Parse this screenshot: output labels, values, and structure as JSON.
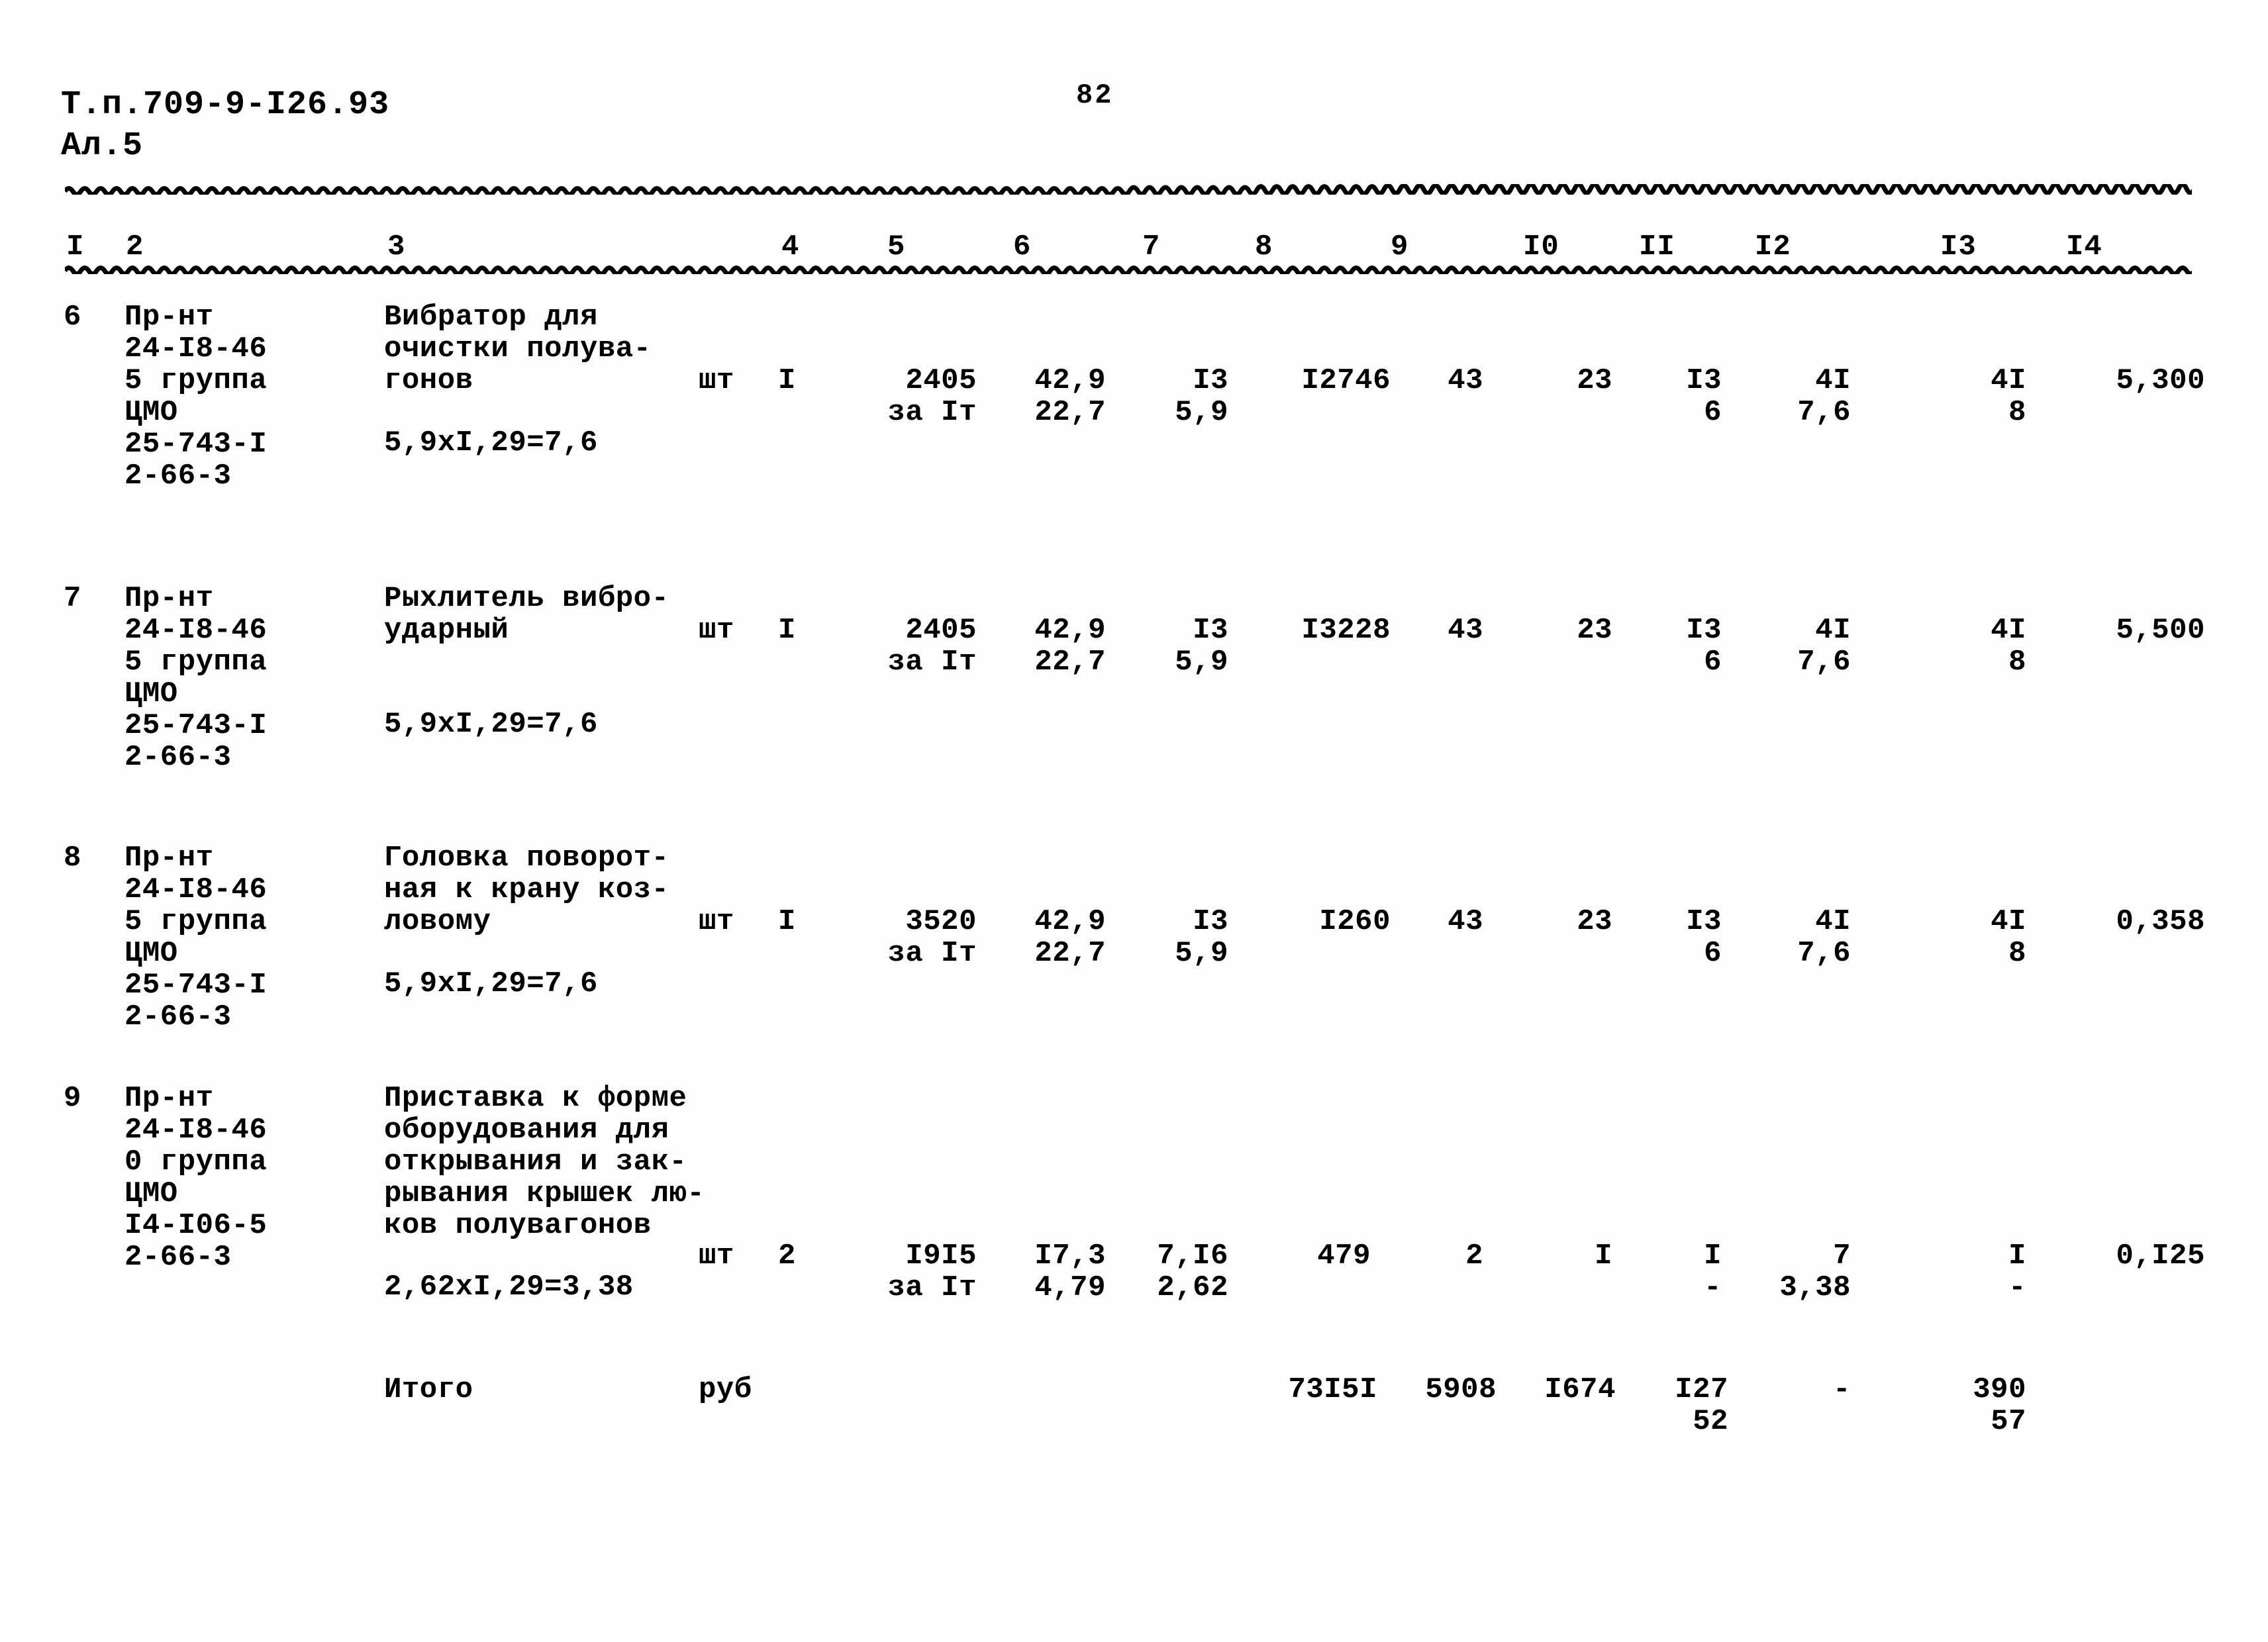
{
  "header": {
    "doc_code_line1": "Т.п.709-9-I26.93",
    "doc_code_line2": "Ал.5",
    "page_number": "82"
  },
  "table": {
    "column_headers": [
      "I",
      "2",
      "3",
      "4",
      "5",
      "6",
      "7",
      "8",
      "9",
      "I0",
      "II",
      "I2",
      "I3",
      "I4"
    ],
    "rows": [
      {
        "index": "6",
        "code": "Пр-нт\n24-I8-46\n5 группа\nЦМО\n25-743-I\n2-66-3",
        "description": "Вибратор для\nочистки полува-\nгонов",
        "formula": "5,9xI,29=7,6",
        "unit": "шт",
        "qty": "I",
        "col5_line1": "2405",
        "col5_line2": "за Iт",
        "col6_line1": "42,9",
        "col6_line2": "22,7",
        "col7_line1": "I3",
        "col7_line2": "5,9",
        "col8": "I2746",
        "col9": "43",
        "col10": "23",
        "col11_line1": "I3",
        "col11_line2": "6",
        "col12_line1": "4I",
        "col12_line2": "7,6",
        "col13_line1": "4I",
        "col13_line2": "8",
        "col14": "5,300"
      },
      {
        "index": "7",
        "code": "Пр-нт\n24-I8-46\n5 группа\nЦМО\n25-743-I\n2-66-3",
        "description": "Рыхлитель вибро-\nударный",
        "formula": "5,9xI,29=7,6",
        "unit": "шт",
        "qty": "I",
        "col5_line1": "2405",
        "col5_line2": "за Iт",
        "col6_line1": "42,9",
        "col6_line2": "22,7",
        "col7_line1": "I3",
        "col7_line2": "5,9",
        "col8": "I3228",
        "col9": "43",
        "col10": "23",
        "col11_line1": "I3",
        "col11_line2": "6",
        "col12_line1": "4I",
        "col12_line2": "7,6",
        "col13_line1": "4I",
        "col13_line2": "8",
        "col14": "5,500"
      },
      {
        "index": "8",
        "code": "Пр-нт\n24-I8-46\n5 группа\nЦМО\n25-743-I\n2-66-3",
        "description": "Головка поворот-\nная к крану коз-\nловому",
        "formula": "5,9xI,29=7,6",
        "unit": "шт",
        "qty": "I",
        "col5_line1": "3520",
        "col5_line2": "за Iт",
        "col6_line1": "42,9",
        "col6_line2": "22,7",
        "col7_line1": "I3",
        "col7_line2": "5,9",
        "col8": "I260",
        "col9": "43",
        "col10": "23",
        "col11_line1": "I3",
        "col11_line2": "6",
        "col12_line1": "4I",
        "col12_line2": "7,6",
        "col13_line1": "4I",
        "col13_line2": "8",
        "col14": "0,358"
      },
      {
        "index": "9",
        "code": "Пр-нт\n24-I8-46\n0 группа\nЦМО\nI4-I06-5\n2-66-3",
        "description": "Приставка к форме\nоборудования для\nоткрывания и зак-\nрывания крышек лю-\nков полувагонов",
        "formula": "2,62xI,29=3,38",
        "unit": "шт",
        "qty": "2",
        "col5_line1": "I9I5",
        "col5_line2": "за Iт",
        "col6_line1": "I7,3",
        "col6_line2": "4,79",
        "col7_line1": "7,I6",
        "col7_line2": "2,62",
        "col8": "479",
        "col9": "2",
        "col10": "I",
        "col11_line1": "I",
        "col11_line2": "-",
        "col12_line1": "7",
        "col12_line2": "3,38",
        "col13_line1": "I",
        "col13_line2": "-",
        "col14": "0,I25"
      }
    ],
    "total_row": {
      "label": "Итого",
      "unit": "руб",
      "col8": "73I5I",
      "col9": "5908",
      "col10": "I674",
      "col11_line1": "I27",
      "col11_line2": "52",
      "col12": "-",
      "col13_line1": "390",
      "col13_line2": "57"
    }
  }
}
